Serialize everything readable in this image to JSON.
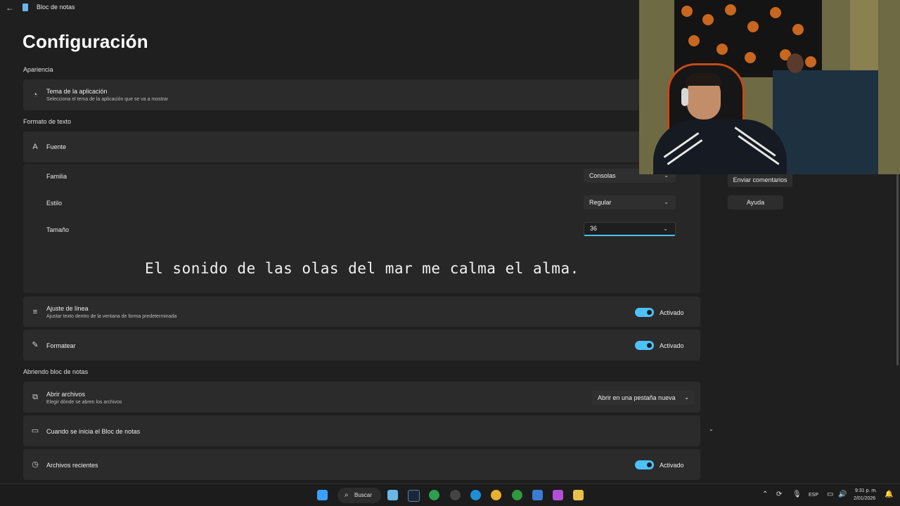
{
  "window": {
    "title": "Bloc de notas"
  },
  "page": {
    "title": "Configuración"
  },
  "sections": {
    "appearance": "Apariencia",
    "text_format": "Formato de texto",
    "opening": "Abriendo bloc de notas"
  },
  "theme": {
    "title": "Tema de la aplicación",
    "subtitle": "Selecciona el tema de la aplicación que se va a mostrar"
  },
  "font": {
    "title": "Fuente",
    "family_label": "Familia",
    "family_value": "Consolas",
    "style_label": "Estilo",
    "style_value": "Regular",
    "size_label": "Tamaño",
    "size_value": "36",
    "preview_text": "El sonido de las olas del mar me calma el alma."
  },
  "word_wrap": {
    "title": "Ajuste de línea",
    "subtitle": "Ajustar texto dentro de la ventana de forma predeterminada",
    "state": "Activado",
    "on": true
  },
  "formatting": {
    "title": "Formatear",
    "state": "Activado",
    "on": true
  },
  "open_files": {
    "title": "Abrir archivos",
    "subtitle": "Elegir dónde se abren los archivos",
    "value": "Abrir en una pestaña nueva"
  },
  "on_start": {
    "title": "Cuando se inicia el Bloc de notas"
  },
  "recent_files": {
    "title": "Archivos recientes",
    "state": "Activado",
    "on": true
  },
  "side": {
    "feedback": "Enviar comentarios",
    "help": "Ayuda"
  },
  "taskbar": {
    "search": "Buscar",
    "language": "ESP",
    "time": "9:31 p. m.",
    "date": "2/01/2026"
  },
  "colors": {
    "accent": "#4cc2ff",
    "background": "#1f1f1f",
    "card": "#2b2b2b"
  }
}
